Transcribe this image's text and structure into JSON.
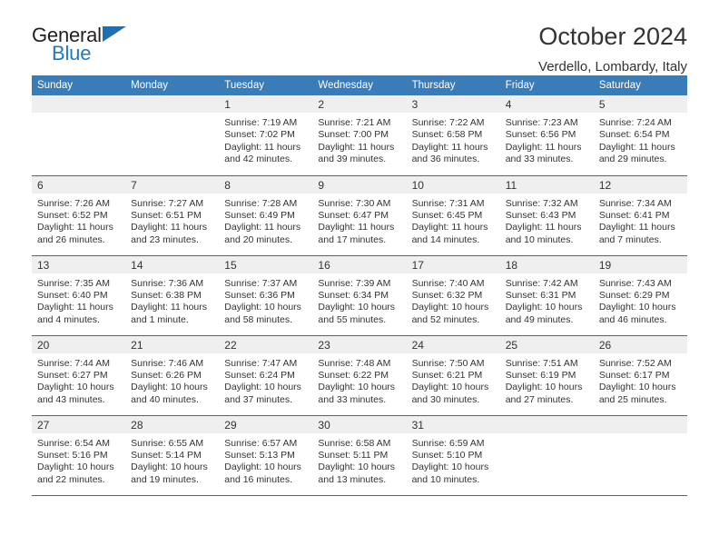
{
  "brand": {
    "name_top": "General",
    "name_bottom": "Blue",
    "triangle_color": "#1f6fb4",
    "blue_text_color": "#1f7ac0"
  },
  "header": {
    "title": "October 2024",
    "subtitle": "Verdello, Lombardy, Italy"
  },
  "theme": {
    "header_blue": "#3a7cb8",
    "rule_blue": "#2e6ca4",
    "daynum_bg": "#efefef"
  },
  "weekdays": [
    "Sunday",
    "Monday",
    "Tuesday",
    "Wednesday",
    "Thursday",
    "Friday",
    "Saturday"
  ],
  "weeks": [
    [
      {
        "day": ""
      },
      {
        "day": ""
      },
      {
        "day": "1",
        "sunrise": "Sunrise: 7:19 AM",
        "sunset": "Sunset: 7:02 PM",
        "daylight_1": "Daylight: 11 hours",
        "daylight_2": "and 42 minutes."
      },
      {
        "day": "2",
        "sunrise": "Sunrise: 7:21 AM",
        "sunset": "Sunset: 7:00 PM",
        "daylight_1": "Daylight: 11 hours",
        "daylight_2": "and 39 minutes."
      },
      {
        "day": "3",
        "sunrise": "Sunrise: 7:22 AM",
        "sunset": "Sunset: 6:58 PM",
        "daylight_1": "Daylight: 11 hours",
        "daylight_2": "and 36 minutes."
      },
      {
        "day": "4",
        "sunrise": "Sunrise: 7:23 AM",
        "sunset": "Sunset: 6:56 PM",
        "daylight_1": "Daylight: 11 hours",
        "daylight_2": "and 33 minutes."
      },
      {
        "day": "5",
        "sunrise": "Sunrise: 7:24 AM",
        "sunset": "Sunset: 6:54 PM",
        "daylight_1": "Daylight: 11 hours",
        "daylight_2": "and 29 minutes."
      }
    ],
    [
      {
        "day": "6",
        "sunrise": "Sunrise: 7:26 AM",
        "sunset": "Sunset: 6:52 PM",
        "daylight_1": "Daylight: 11 hours",
        "daylight_2": "and 26 minutes."
      },
      {
        "day": "7",
        "sunrise": "Sunrise: 7:27 AM",
        "sunset": "Sunset: 6:51 PM",
        "daylight_1": "Daylight: 11 hours",
        "daylight_2": "and 23 minutes."
      },
      {
        "day": "8",
        "sunrise": "Sunrise: 7:28 AM",
        "sunset": "Sunset: 6:49 PM",
        "daylight_1": "Daylight: 11 hours",
        "daylight_2": "and 20 minutes."
      },
      {
        "day": "9",
        "sunrise": "Sunrise: 7:30 AM",
        "sunset": "Sunset: 6:47 PM",
        "daylight_1": "Daylight: 11 hours",
        "daylight_2": "and 17 minutes."
      },
      {
        "day": "10",
        "sunrise": "Sunrise: 7:31 AM",
        "sunset": "Sunset: 6:45 PM",
        "daylight_1": "Daylight: 11 hours",
        "daylight_2": "and 14 minutes."
      },
      {
        "day": "11",
        "sunrise": "Sunrise: 7:32 AM",
        "sunset": "Sunset: 6:43 PM",
        "daylight_1": "Daylight: 11 hours",
        "daylight_2": "and 10 minutes."
      },
      {
        "day": "12",
        "sunrise": "Sunrise: 7:34 AM",
        "sunset": "Sunset: 6:41 PM",
        "daylight_1": "Daylight: 11 hours",
        "daylight_2": "and 7 minutes."
      }
    ],
    [
      {
        "day": "13",
        "sunrise": "Sunrise: 7:35 AM",
        "sunset": "Sunset: 6:40 PM",
        "daylight_1": "Daylight: 11 hours",
        "daylight_2": "and 4 minutes."
      },
      {
        "day": "14",
        "sunrise": "Sunrise: 7:36 AM",
        "sunset": "Sunset: 6:38 PM",
        "daylight_1": "Daylight: 11 hours",
        "daylight_2": "and 1 minute."
      },
      {
        "day": "15",
        "sunrise": "Sunrise: 7:37 AM",
        "sunset": "Sunset: 6:36 PM",
        "daylight_1": "Daylight: 10 hours",
        "daylight_2": "and 58 minutes."
      },
      {
        "day": "16",
        "sunrise": "Sunrise: 7:39 AM",
        "sunset": "Sunset: 6:34 PM",
        "daylight_1": "Daylight: 10 hours",
        "daylight_2": "and 55 minutes."
      },
      {
        "day": "17",
        "sunrise": "Sunrise: 7:40 AM",
        "sunset": "Sunset: 6:32 PM",
        "daylight_1": "Daylight: 10 hours",
        "daylight_2": "and 52 minutes."
      },
      {
        "day": "18",
        "sunrise": "Sunrise: 7:42 AM",
        "sunset": "Sunset: 6:31 PM",
        "daylight_1": "Daylight: 10 hours",
        "daylight_2": "and 49 minutes."
      },
      {
        "day": "19",
        "sunrise": "Sunrise: 7:43 AM",
        "sunset": "Sunset: 6:29 PM",
        "daylight_1": "Daylight: 10 hours",
        "daylight_2": "and 46 minutes."
      }
    ],
    [
      {
        "day": "20",
        "sunrise": "Sunrise: 7:44 AM",
        "sunset": "Sunset: 6:27 PM",
        "daylight_1": "Daylight: 10 hours",
        "daylight_2": "and 43 minutes."
      },
      {
        "day": "21",
        "sunrise": "Sunrise: 7:46 AM",
        "sunset": "Sunset: 6:26 PM",
        "daylight_1": "Daylight: 10 hours",
        "daylight_2": "and 40 minutes."
      },
      {
        "day": "22",
        "sunrise": "Sunrise: 7:47 AM",
        "sunset": "Sunset: 6:24 PM",
        "daylight_1": "Daylight: 10 hours",
        "daylight_2": "and 37 minutes."
      },
      {
        "day": "23",
        "sunrise": "Sunrise: 7:48 AM",
        "sunset": "Sunset: 6:22 PM",
        "daylight_1": "Daylight: 10 hours",
        "daylight_2": "and 33 minutes."
      },
      {
        "day": "24",
        "sunrise": "Sunrise: 7:50 AM",
        "sunset": "Sunset: 6:21 PM",
        "daylight_1": "Daylight: 10 hours",
        "daylight_2": "and 30 minutes."
      },
      {
        "day": "25",
        "sunrise": "Sunrise: 7:51 AM",
        "sunset": "Sunset: 6:19 PM",
        "daylight_1": "Daylight: 10 hours",
        "daylight_2": "and 27 minutes."
      },
      {
        "day": "26",
        "sunrise": "Sunrise: 7:52 AM",
        "sunset": "Sunset: 6:17 PM",
        "daylight_1": "Daylight: 10 hours",
        "daylight_2": "and 25 minutes."
      }
    ],
    [
      {
        "day": "27",
        "sunrise": "Sunrise: 6:54 AM",
        "sunset": "Sunset: 5:16 PM",
        "daylight_1": "Daylight: 10 hours",
        "daylight_2": "and 22 minutes."
      },
      {
        "day": "28",
        "sunrise": "Sunrise: 6:55 AM",
        "sunset": "Sunset: 5:14 PM",
        "daylight_1": "Daylight: 10 hours",
        "daylight_2": "and 19 minutes."
      },
      {
        "day": "29",
        "sunrise": "Sunrise: 6:57 AM",
        "sunset": "Sunset: 5:13 PM",
        "daylight_1": "Daylight: 10 hours",
        "daylight_2": "and 16 minutes."
      },
      {
        "day": "30",
        "sunrise": "Sunrise: 6:58 AM",
        "sunset": "Sunset: 5:11 PM",
        "daylight_1": "Daylight: 10 hours",
        "daylight_2": "and 13 minutes."
      },
      {
        "day": "31",
        "sunrise": "Sunrise: 6:59 AM",
        "sunset": "Sunset: 5:10 PM",
        "daylight_1": "Daylight: 10 hours",
        "daylight_2": "and 10 minutes."
      },
      {
        "day": ""
      },
      {
        "day": ""
      }
    ]
  ]
}
